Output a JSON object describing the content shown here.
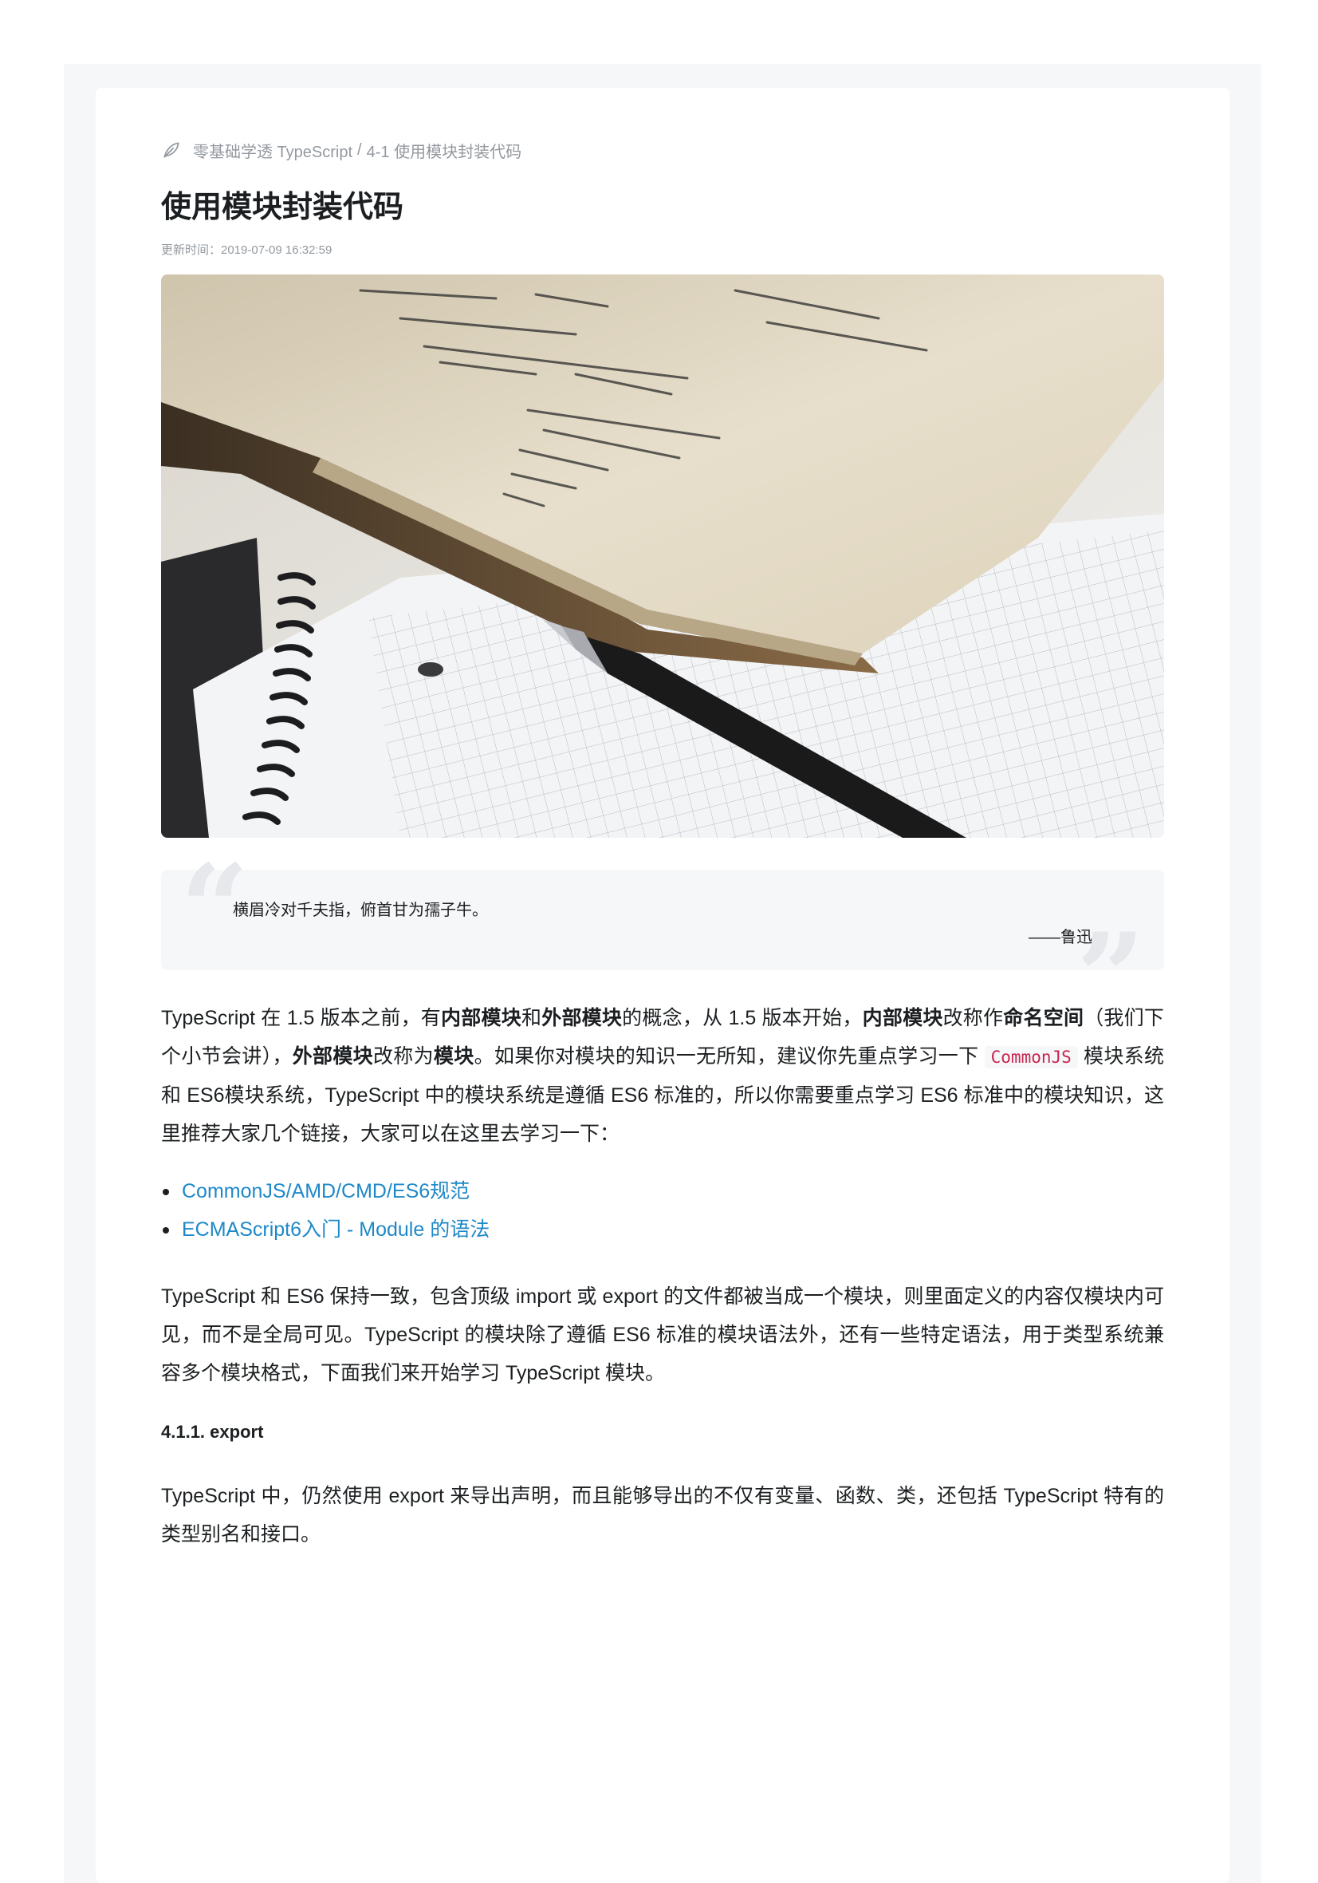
{
  "breadcrumb": {
    "icon": "leaf-icon",
    "course": "零基础学透 TypeScript",
    "separator": "/",
    "chapter": "4-1 使用模块封装代码"
  },
  "title": "使用模块封装代码",
  "updated": "更新时间：2019-07-09 16:32:59",
  "hero_image": {
    "alt": "open math book, spiral notebook with grid paper and a fountain pen"
  },
  "quote": {
    "text": "横眉冷对千夫指，俯首甘为孺子牛。",
    "author": "——鲁迅"
  },
  "intro": {
    "p1": "TypeScript 在 1.5 版本之前，有",
    "b1": "内部模块",
    "p2": "和",
    "b2": "外部模块",
    "p3": "的概念，从 1.5 版本开始，",
    "b3": "内部模块",
    "p4": "改称作",
    "b4": "命名空间",
    "p5": "（我们下个小节会讲），",
    "b5": "外部模块",
    "p6": "改称为",
    "b6": "模块",
    "p7": "。如果你对模块的知识一无所知，建议你先重点学习一下 ",
    "code": "CommonJS",
    "p8": " 模块系统和 ES6模块系统，TypeScript 中的模块系统是遵循 ES6 标准的，所以你需要重点学习 ES6 标准中的模块知识，这里推荐大家几个链接，大家可以在这里去学习一下："
  },
  "links": [
    "CommonJS/AMD/CMD/ES6规范",
    "ECMAScript6入门 - Module 的语法"
  ],
  "para2": "TypeScript 和 ES6 保持一致，包含顶级 import 或 export 的文件都被当成一个模块，则里面定义的内容仅模块内可见，而不是全局可见。TypeScript 的模块除了遵循 ES6 标准的模块语法外，还有一些特定语法，用于类型系统兼容多个模块格式，下面我们来开始学习 TypeScript 模块。",
  "section": {
    "heading": "4.1.1. export",
    "text": "TypeScript 中，仍然使用 export 来导出声明，而且能够导出的不仅有变量、函数、类，还包括 TypeScript 特有的类型别名和接口。"
  }
}
